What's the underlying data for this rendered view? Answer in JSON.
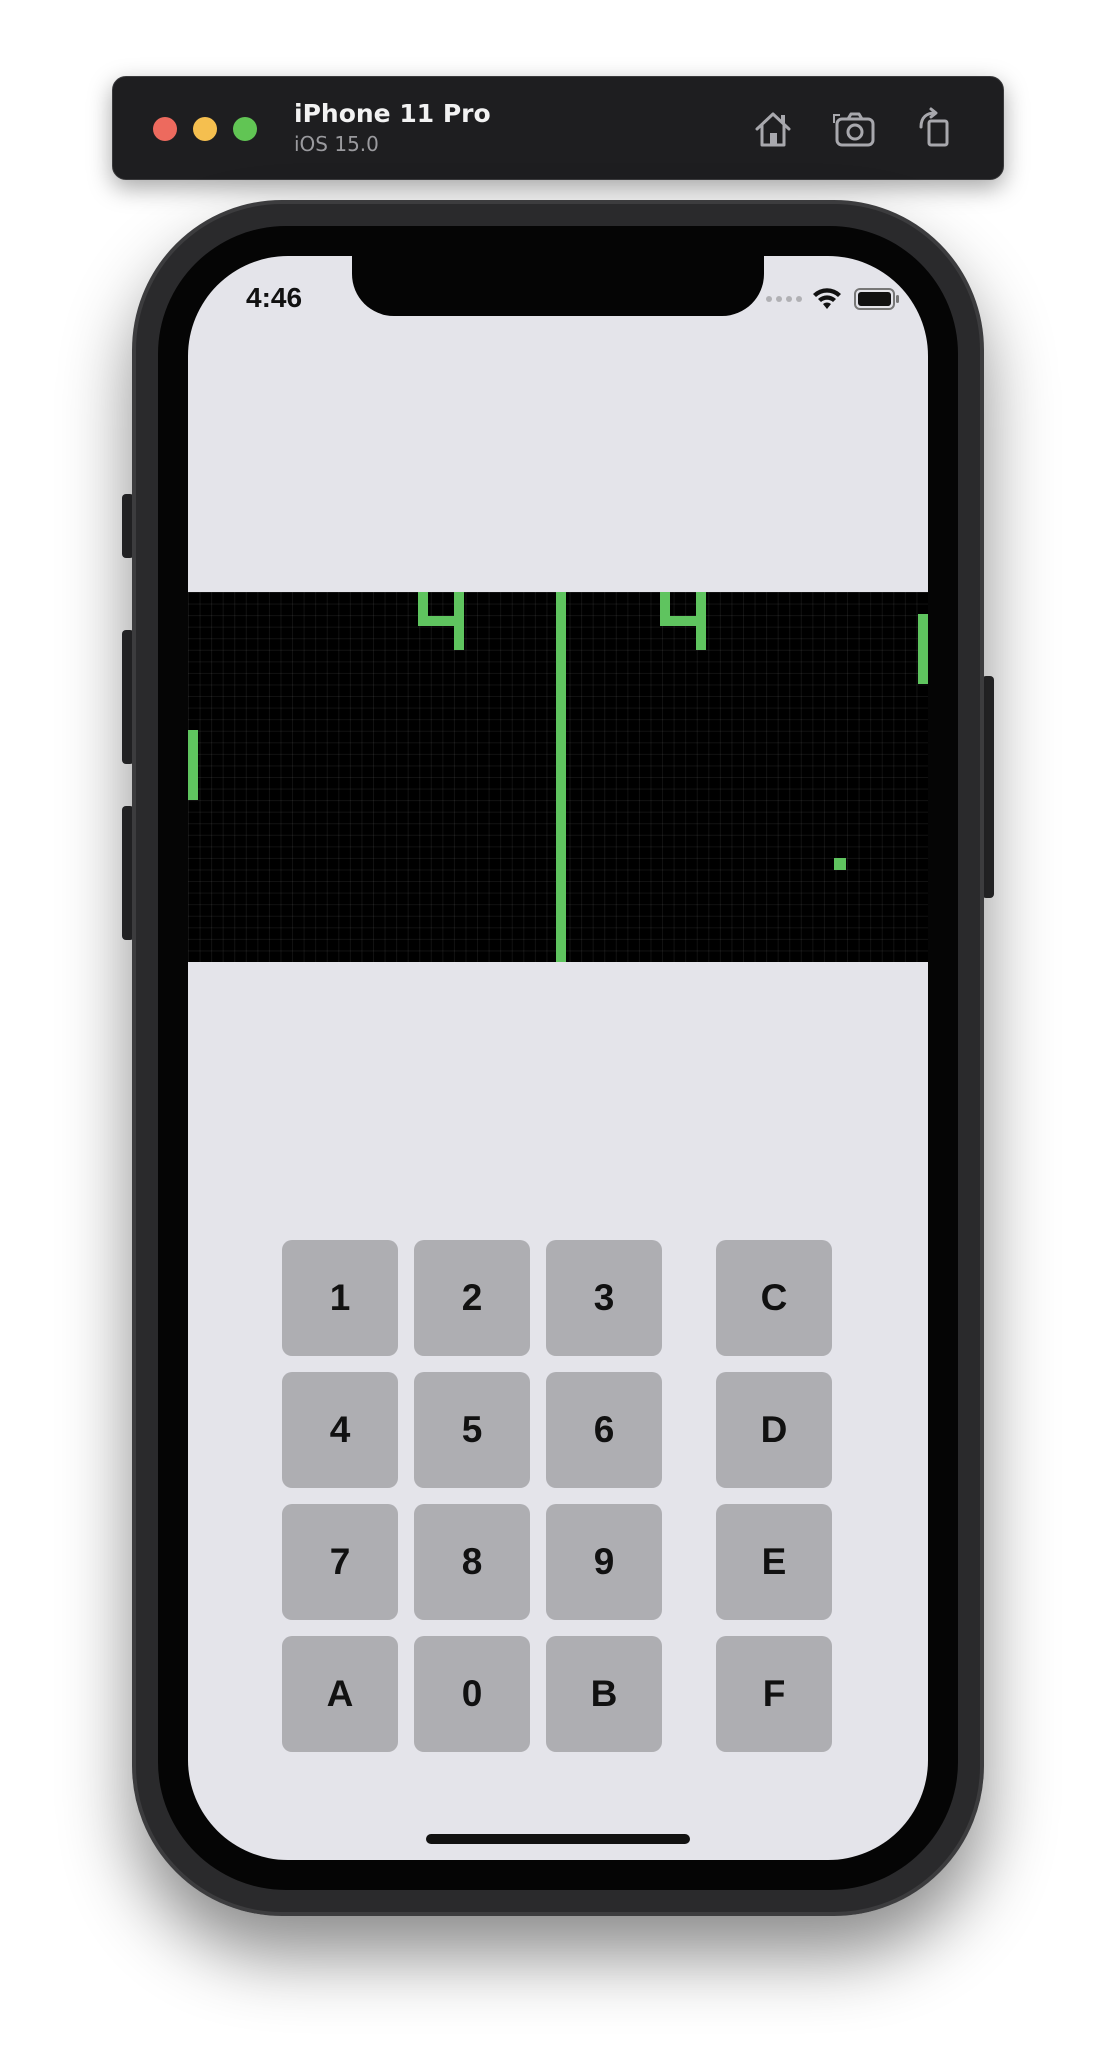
{
  "simulator": {
    "device_name": "iPhone 11 Pro",
    "os_version": "iOS 15.0",
    "buttons": [
      "home-icon",
      "screenshot-icon",
      "rotate-icon"
    ]
  },
  "status_bar": {
    "time": "4:46"
  },
  "game": {
    "colors": {
      "background": "#000000",
      "foreground": "#5fc45f",
      "grid": "#1e1e1e"
    },
    "scores": {
      "left": "4",
      "right": "4"
    }
  },
  "keypad": {
    "rows": [
      [
        "1",
        "2",
        "3",
        "C"
      ],
      [
        "4",
        "5",
        "6",
        "D"
      ],
      [
        "7",
        "8",
        "9",
        "E"
      ],
      [
        "A",
        "0",
        "B",
        "F"
      ]
    ]
  }
}
